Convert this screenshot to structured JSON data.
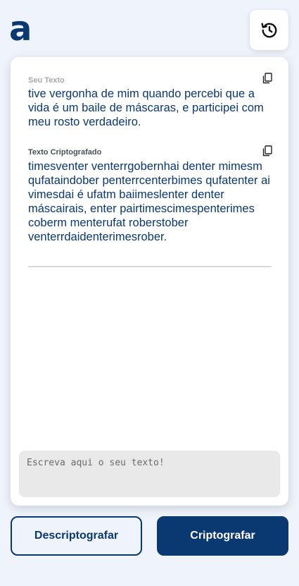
{
  "header": {
    "logo_text": "a",
    "history_icon": "history-icon"
  },
  "card": {
    "input_label": "Seu Texto",
    "input_text": "tive vergonha de mim quando percebi que a vida é um baile de máscaras, e participei com meu rosto verdadeiro.",
    "output_label": "Texto Criptografado",
    "output_text": "timesventer venterrgobernhai denter mimesm qufataindober penterrcenterbimes qufatenter ai vimesdai é ufatm baiimeslenter denter máscairais, enter pairtimescimespenterimes coberm menterufat roberstober venterrdaidenterimesrober.",
    "copy_icon": "copy-icon",
    "textarea_placeholder": "Escreva aqui o seu texto!"
  },
  "actions": {
    "decrypt_label": "Descriptografar",
    "encrypt_label": "Criptografar"
  },
  "colors": {
    "primary": "#0a3871",
    "background": "#eff3fc",
    "card": "#ffffff"
  }
}
